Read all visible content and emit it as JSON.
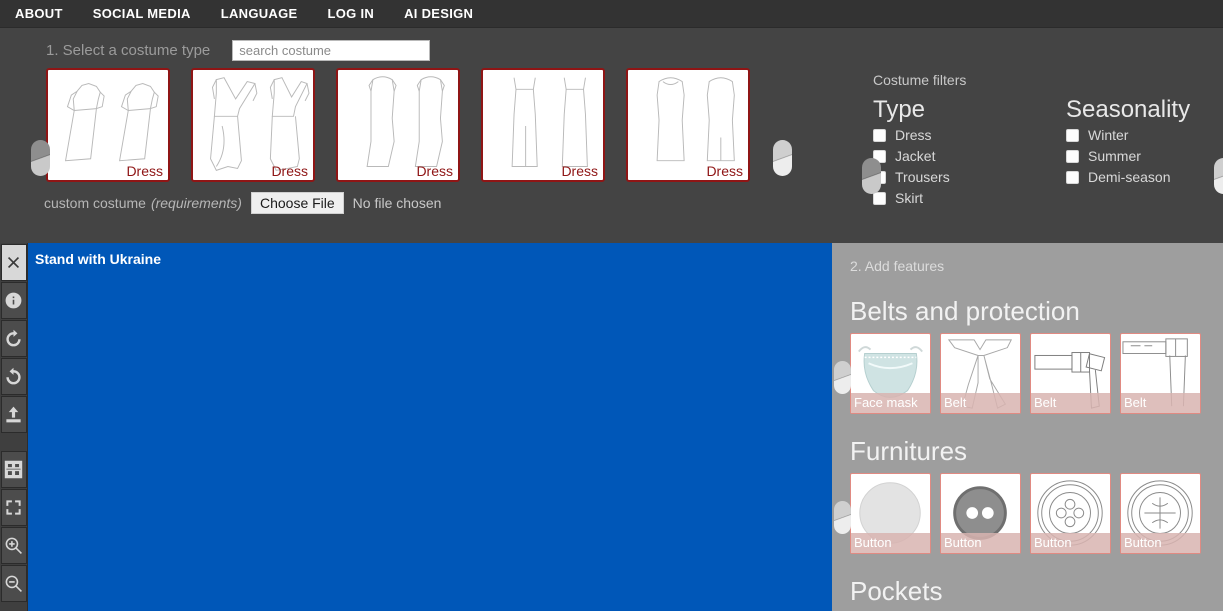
{
  "nav": {
    "items": [
      {
        "label": "ABOUT",
        "name": "nav-about"
      },
      {
        "label": "SOCIAL MEDIA",
        "name": "nav-social-media"
      },
      {
        "label": "LANGUAGE",
        "name": "nav-language"
      },
      {
        "label": "LOG IN",
        "name": "nav-log-in"
      },
      {
        "label": "AI DESIGN",
        "name": "nav-ai-design"
      }
    ]
  },
  "step1": {
    "label": "1. Select a costume type",
    "search_placeholder": "search costume",
    "search_value": "",
    "costumes": [
      {
        "label": "Dress",
        "art": "dress-flutter-sleeve"
      },
      {
        "label": "Dress",
        "art": "dress-wrap-ruffle"
      },
      {
        "label": "Dress",
        "art": "dress-sleeveless-mermaid"
      },
      {
        "label": "Dress",
        "art": "dress-strap-maxi"
      },
      {
        "label": "Dress",
        "art": "dress-sheath-midi"
      }
    ],
    "custom_costume_label": "custom costume",
    "custom_costume_requirements": "(requirements)",
    "choose_file_label": "Choose File",
    "no_file_label": "No file chosen"
  },
  "filters": {
    "title": "Costume filters",
    "groups": [
      {
        "heading": "Type",
        "options": [
          {
            "label": "Dress",
            "checked": false
          },
          {
            "label": "Jacket",
            "checked": false
          },
          {
            "label": "Trousers",
            "checked": false
          },
          {
            "label": "Skirt",
            "checked": false
          }
        ]
      },
      {
        "heading": "Seasonality",
        "options": [
          {
            "label": "Winter",
            "checked": false
          },
          {
            "label": "Summer",
            "checked": false
          },
          {
            "label": "Demi-season",
            "checked": false
          }
        ]
      }
    ]
  },
  "toolbar": {
    "items": [
      {
        "name": "close-icon"
      },
      {
        "name": "info-icon"
      },
      {
        "name": "undo-icon"
      },
      {
        "name": "redo-icon"
      },
      {
        "name": "upload-icon"
      },
      {
        "name": "grid-icon"
      },
      {
        "name": "fullscreen-icon"
      },
      {
        "name": "zoom-in-icon"
      },
      {
        "name": "zoom-out-icon"
      }
    ]
  },
  "canvas": {
    "banner_text": "Stand with Ukraine",
    "background_color": "#0057b8"
  },
  "step2": {
    "label": "2. Add features",
    "sections": [
      {
        "heading": "Belts and protection",
        "items": [
          {
            "label": "Face mask",
            "art": "face-mask"
          },
          {
            "label": "Belt",
            "art": "belt-bow"
          },
          {
            "label": "Belt",
            "art": "belt-buckle"
          },
          {
            "label": "Belt",
            "art": "belt-wide"
          }
        ]
      },
      {
        "heading": "Furnitures",
        "items": [
          {
            "label": "Button",
            "art": "button-plain"
          },
          {
            "label": "Button",
            "art": "button-2hole-dark"
          },
          {
            "label": "Button",
            "art": "button-4hole"
          },
          {
            "label": "Button",
            "art": "button-shank"
          }
        ]
      },
      {
        "heading": "Pockets",
        "items": []
      }
    ]
  },
  "colors": {
    "nav_bg": "#333333",
    "upper_bg": "#444444",
    "panel_bg": "#9e9e9e",
    "card_border": "#8f1515",
    "feature_card_border": "#e08a82",
    "canvas_blue": "#0057b8"
  }
}
